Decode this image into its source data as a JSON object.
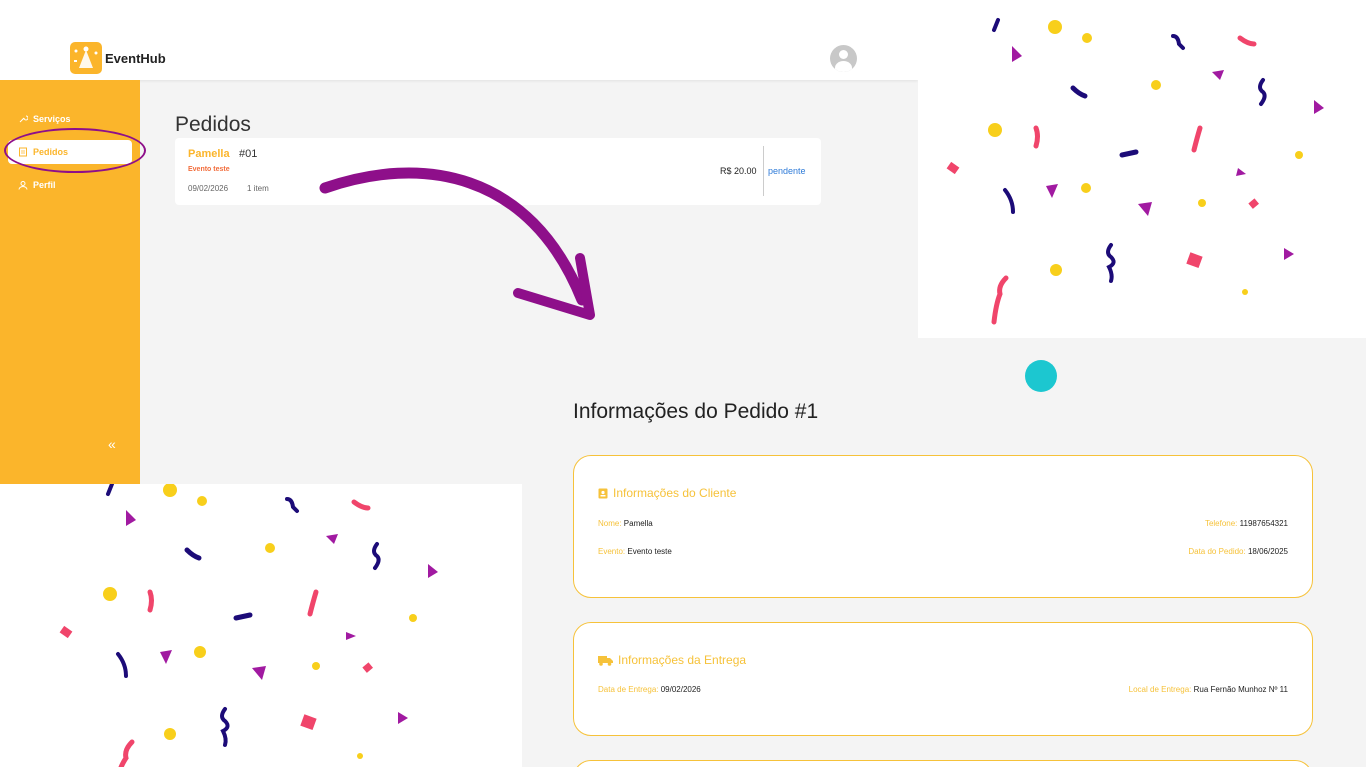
{
  "app": {
    "name": "EventHub"
  },
  "sidebar": {
    "items": [
      {
        "label": "Serviços",
        "icon": "wrench-icon"
      },
      {
        "label": "Pedidos",
        "icon": "document-icon"
      },
      {
        "label": "Perfil",
        "icon": "user-icon"
      }
    ],
    "collapse_label": "«"
  },
  "pedidos": {
    "title": "Pedidos",
    "order": {
      "name": "Pamella",
      "number": "#01",
      "event": "Evento teste",
      "date": "09/02/2026",
      "items": "1 item",
      "price": "R$ 20.00",
      "status": "pendente"
    }
  },
  "info": {
    "title": "Informações do Pedido #1",
    "cliente": {
      "heading": "Informações do Cliente",
      "nome_label": "Nome:",
      "nome_value": "Pamella",
      "telefone_label": "Telefone:",
      "telefone_value": "11987654321",
      "evento_label": "Evento:",
      "evento_value": "Evento teste",
      "data_label": "Data do Pedido:",
      "data_value": "18/06/2025"
    },
    "entrega": {
      "heading": "Informações da Entrega",
      "data_label": "Data de Entrega:",
      "data_value": "09/02/2026",
      "local_label": "Local de Entrega:",
      "local_value": "Rua Fernão Munhoz Nº 11"
    }
  },
  "colors": {
    "accent": "#fbb52b",
    "annotation": "#8e0f8a",
    "teal": "#1cc7d0",
    "status_blue": "#2f7bd8"
  }
}
